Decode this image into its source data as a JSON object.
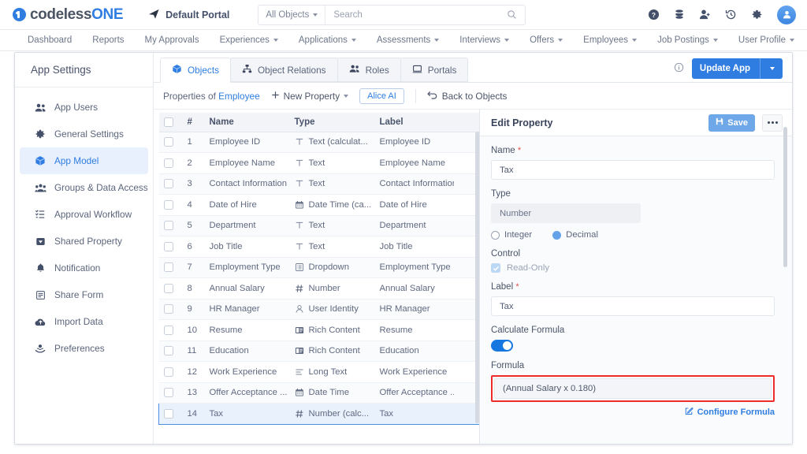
{
  "brand": {
    "name_plain": "codeless",
    "name_bold": "ONE"
  },
  "topbar": {
    "portal": "Default Portal",
    "search": {
      "scope": "All Objects",
      "placeholder": "Search",
      "value": ""
    },
    "icons": [
      "help-icon",
      "database-icon",
      "add-user-icon",
      "history-icon",
      "gear-icon",
      "avatar"
    ]
  },
  "menubar": {
    "items": [
      {
        "label": "Dashboard",
        "caret": false
      },
      {
        "label": "Reports",
        "caret": false
      },
      {
        "label": "My Approvals",
        "caret": false
      },
      {
        "label": "Experiences",
        "caret": true
      },
      {
        "label": "Applications",
        "caret": true
      },
      {
        "label": "Assessments",
        "caret": true
      },
      {
        "label": "Interviews",
        "caret": true
      },
      {
        "label": "Offers",
        "caret": true
      },
      {
        "label": "Employees",
        "caret": true
      },
      {
        "label": "Job Postings",
        "caret": true
      },
      {
        "label": "User Profile",
        "caret": true
      }
    ]
  },
  "sidebar": {
    "title": "App Settings",
    "items": [
      {
        "label": "App Users",
        "icon": "users-icon",
        "active": false
      },
      {
        "label": "General Settings",
        "icon": "gear-icon",
        "active": false
      },
      {
        "label": "App Model",
        "icon": "cube-icon",
        "active": true
      },
      {
        "label": "Groups & Data Access",
        "icon": "group-icon",
        "active": false
      },
      {
        "label": "Approval Workflow",
        "icon": "checklist-icon",
        "active": false
      },
      {
        "label": "Shared Property",
        "icon": "tag-icon",
        "active": false
      },
      {
        "label": "Notification",
        "icon": "bell-icon",
        "active": false
      },
      {
        "label": "Share Form",
        "icon": "form-icon",
        "active": false
      },
      {
        "label": "Import Data",
        "icon": "cloud-upload-icon",
        "active": false
      },
      {
        "label": "Preferences",
        "icon": "hand-icon",
        "active": false
      }
    ]
  },
  "tabs": [
    {
      "label": "Objects",
      "icon": "cube-icon",
      "active": true
    },
    {
      "label": "Object Relations",
      "icon": "relations-icon",
      "active": false
    },
    {
      "label": "Roles",
      "icon": "users-icon",
      "active": false
    },
    {
      "label": "Portals",
      "icon": "portal-icon",
      "active": false
    }
  ],
  "tab_actions": {
    "info_icon": "info-icon",
    "update_app": "Update App"
  },
  "toolbar": {
    "properties_of": "Properties of",
    "object_name": "Employee",
    "new_property": "New Property",
    "alice_ai": "Alice AI",
    "back_to_objects": "Back to Objects"
  },
  "table": {
    "columns": [
      "",
      "#",
      "Name",
      "Type",
      "Label",
      ""
    ],
    "rows": [
      {
        "num": "1",
        "name": "Employee ID",
        "type": "Text (calculat...",
        "type_icon": "text-icon",
        "label": "Employee ID",
        "dot": true,
        "selected": false
      },
      {
        "num": "2",
        "name": "Employee Name",
        "type": "Text",
        "type_icon": "text-icon",
        "label": "Employee Name",
        "dot": false,
        "selected": false
      },
      {
        "num": "3",
        "name": "Contact Information",
        "type": "Text",
        "type_icon": "text-icon",
        "label": "Contact Information",
        "dot": false,
        "selected": false
      },
      {
        "num": "4",
        "name": "Date of Hire",
        "type": "Date Time (ca...",
        "type_icon": "calendar-icon",
        "label": "Date of Hire",
        "dot": true,
        "selected": false
      },
      {
        "num": "5",
        "name": "Department",
        "type": "Text",
        "type_icon": "text-icon",
        "label": "Department",
        "dot": false,
        "selected": false
      },
      {
        "num": "6",
        "name": "Job Title",
        "type": "Text",
        "type_icon": "text-icon",
        "label": "Job Title",
        "dot": false,
        "selected": false
      },
      {
        "num": "7",
        "name": "Employment Type",
        "type": "Dropdown",
        "type_icon": "dropdown-icon",
        "label": "Employment Type",
        "dot": false,
        "selected": false
      },
      {
        "num": "8",
        "name": "Annual Salary",
        "type": "Number",
        "type_icon": "number-icon",
        "label": "Annual Salary",
        "dot": false,
        "selected": false
      },
      {
        "num": "9",
        "name": "HR Manager",
        "type": "User Identity",
        "type_icon": "user-icon",
        "label": "HR Manager",
        "dot": false,
        "selected": false
      },
      {
        "num": "10",
        "name": "Resume",
        "type": "Rich Content",
        "type_icon": "rich-content-icon",
        "label": "Resume",
        "dot": false,
        "selected": false
      },
      {
        "num": "11",
        "name": "Education",
        "type": "Rich Content",
        "type_icon": "rich-content-icon",
        "label": "Education",
        "dot": false,
        "selected": false
      },
      {
        "num": "12",
        "name": "Work Experience",
        "type": "Long Text",
        "type_icon": "long-text-icon",
        "label": "Work Experience",
        "dot": false,
        "selected": false
      },
      {
        "num": "13",
        "name": "Offer Acceptance ...",
        "type": "Date Time",
        "type_icon": "calendar-icon",
        "label": "Offer Acceptance ...",
        "dot": false,
        "selected": false
      },
      {
        "num": "14",
        "name": "Tax",
        "type": "Number (calc...",
        "type_icon": "number-icon",
        "label": "Tax",
        "dot": true,
        "selected": true
      }
    ]
  },
  "edit_panel": {
    "title": "Edit Property",
    "save_label": "Save",
    "name_label": "Name",
    "name_value": "Tax",
    "type_label": "Type",
    "type_value": "Number",
    "number_kind": {
      "integer": "Integer",
      "decimal": "Decimal",
      "selected": "Decimal"
    },
    "control_label": "Control",
    "readonly_label": "Read-Only",
    "readonly_checked": true,
    "label_label": "Label",
    "label_value": "Tax",
    "calculate_formula_label": "Calculate Formula",
    "calculate_formula_on": true,
    "formula_label": "Formula",
    "formula_value": "(Annual Salary x 0.180)",
    "configure_formula": "Configure Formula"
  },
  "colors": {
    "accent": "#2f7de1",
    "dot": "#fdc500",
    "highlight_outline": "#ef2b2b",
    "selected_row": "#e9f1fd"
  }
}
